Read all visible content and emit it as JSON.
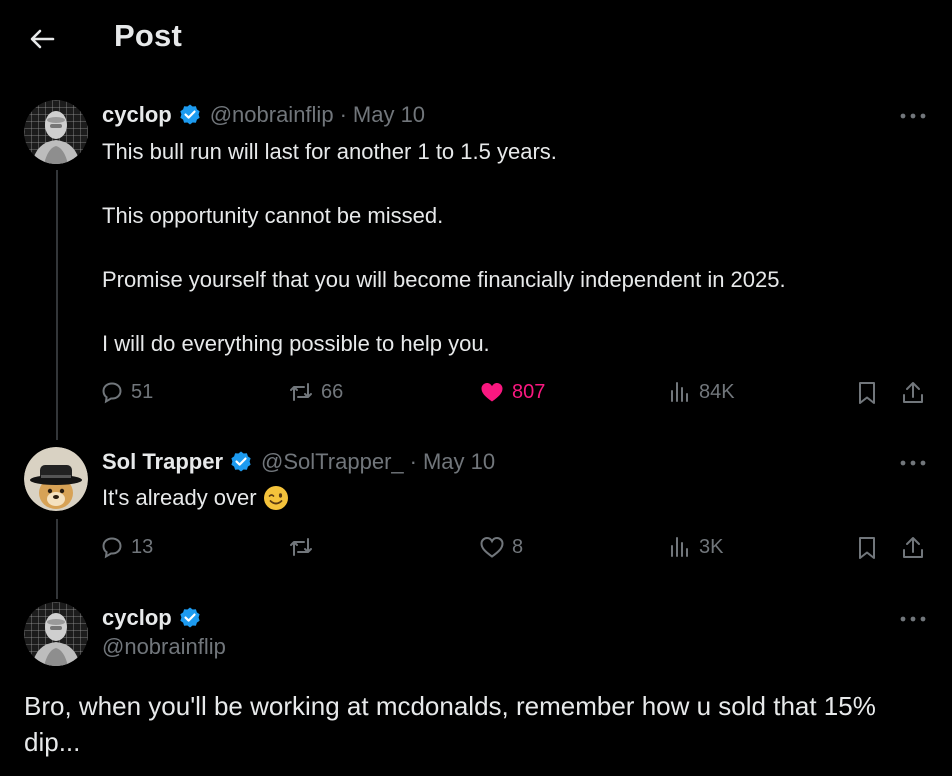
{
  "header": {
    "title": "Post"
  },
  "tweets": [
    {
      "name": "cyclop",
      "handle": "@nobrainflip",
      "separator": "·",
      "date": "May 10",
      "paragraphs": [
        "This bull run will last for another 1 to 1.5 years.",
        "This opportunity cannot be missed.",
        "Promise yourself that you will become financially independent in 2025.",
        "I will do everything possible to help you."
      ],
      "stats": {
        "replies": "51",
        "reposts": "66",
        "likes": "807",
        "views": "84K"
      }
    },
    {
      "name": "Sol Trapper",
      "handle": "@SolTrapper_",
      "separator": "·",
      "date": "May 10",
      "text": "It's already over",
      "emoji": "😉",
      "stats": {
        "replies": "13",
        "likes": "8",
        "views": "3K"
      }
    }
  ],
  "main_post": {
    "name": "cyclop",
    "handle": "@nobrainflip",
    "text": "Bro, when you'll be working at mcdonalds, remember how u sold that 15% dip..."
  },
  "colors": {
    "background": "#000000",
    "text": "#e7e9ea",
    "muted": "#71767b",
    "like_active": "#f91880",
    "verified": "#1d9bf0"
  }
}
